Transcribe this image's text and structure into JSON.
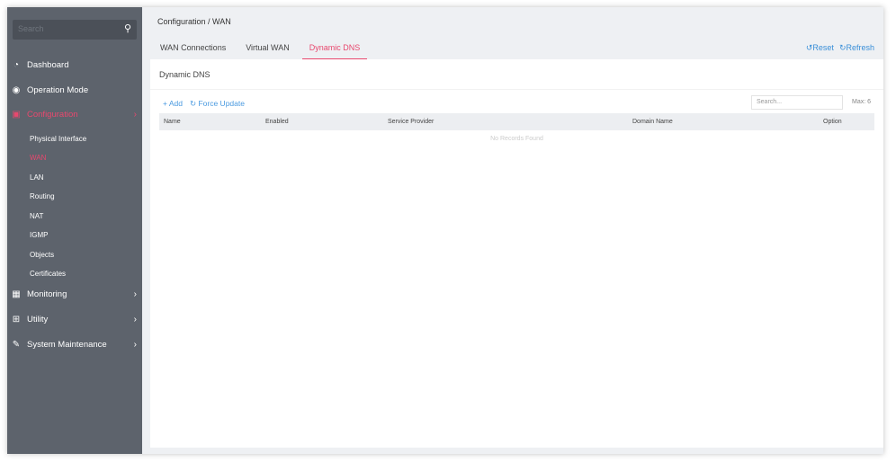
{
  "sidebar": {
    "search_placeholder": "Search",
    "items": [
      {
        "label": "Dashboard"
      },
      {
        "label": "Operation Mode"
      },
      {
        "label": "Configuration"
      },
      {
        "label": "Monitoring"
      },
      {
        "label": "Utility"
      },
      {
        "label": "System Maintenance"
      }
    ],
    "sub_items": [
      {
        "label": "Physical Interface"
      },
      {
        "label": "WAN"
      },
      {
        "label": "LAN"
      },
      {
        "label": "Routing"
      },
      {
        "label": "NAT"
      },
      {
        "label": "IGMP"
      },
      {
        "label": "Objects"
      },
      {
        "label": "Certificates"
      }
    ]
  },
  "header": {
    "breadcrumb": "Configuration / WAN",
    "tabs": [
      "WAN Connections",
      "Virtual WAN",
      "Dynamic DNS"
    ],
    "reset": "Reset",
    "refresh": "Refresh"
  },
  "card": {
    "title": "Dynamic DNS",
    "add": "+ Add",
    "force_update": "Force Update",
    "search_placeholder": "Search...",
    "max": "Max: 6",
    "columns": [
      "Name",
      "Enabled",
      "Service Provider",
      "Domain Name",
      "Option"
    ],
    "empty": "No Records Found"
  },
  "colors": {
    "accent": "#e8486e",
    "link": "#3a8fd8",
    "sidebar": "#5d636c"
  }
}
